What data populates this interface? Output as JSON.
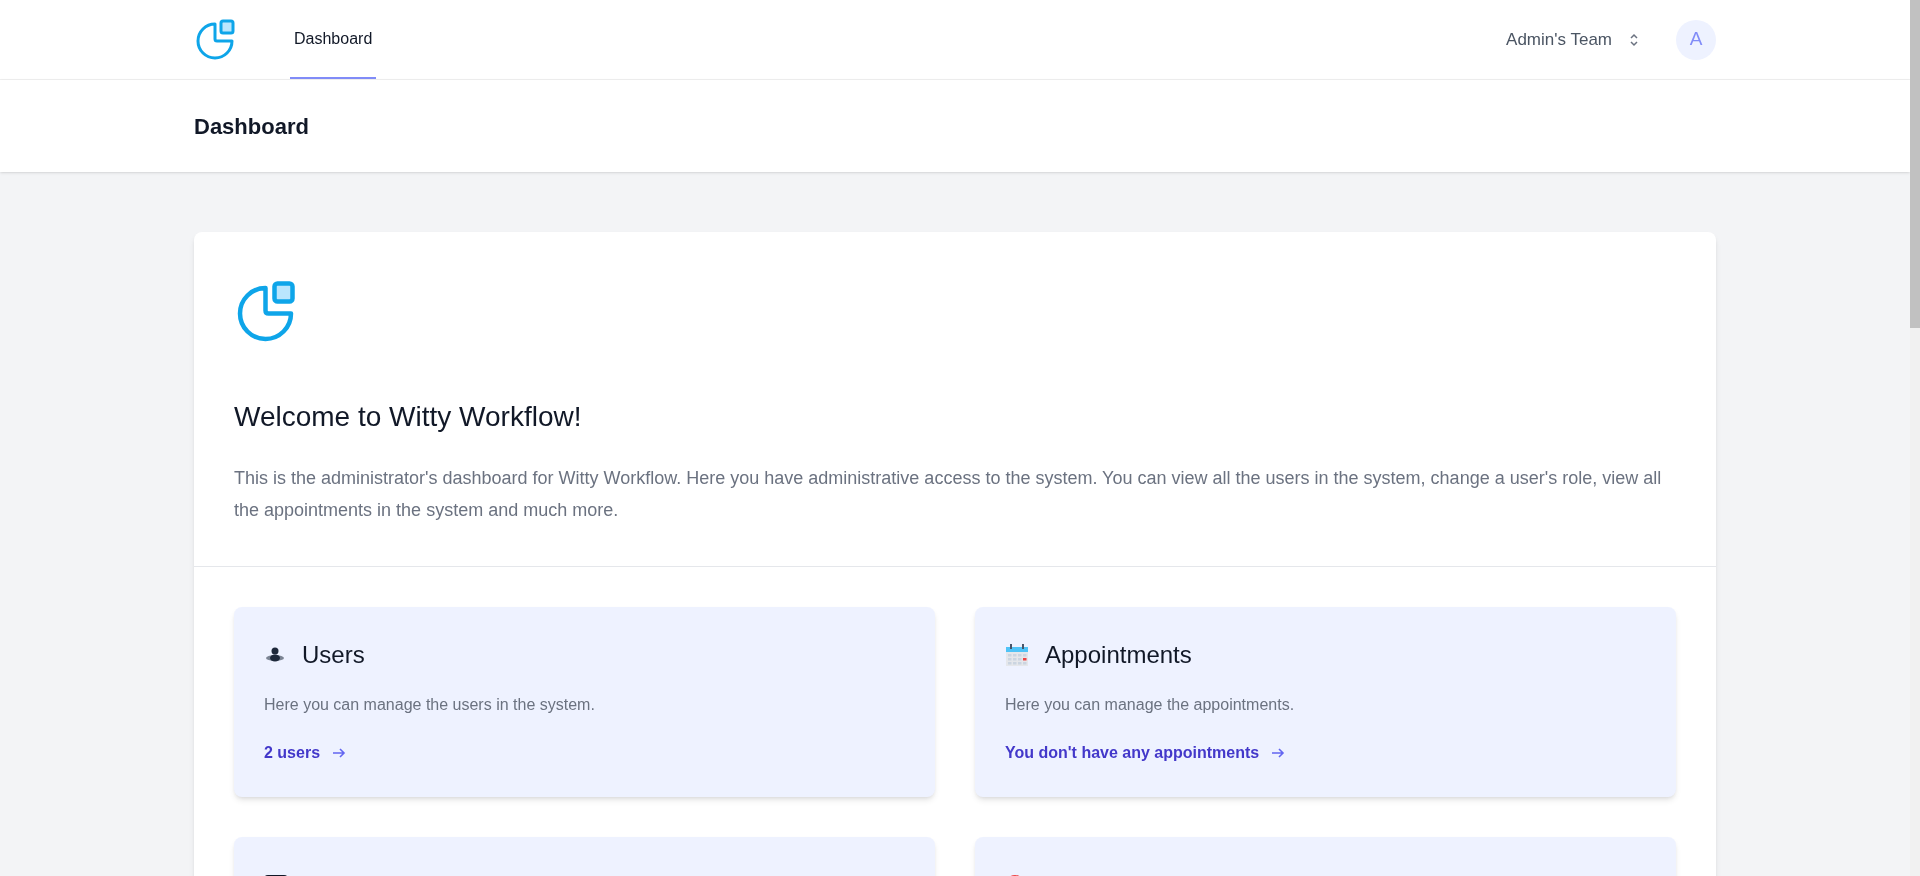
{
  "nav": {
    "tabs": [
      {
        "label": "Dashboard",
        "selected": true
      }
    ],
    "team": "Admin's Team",
    "avatar": "A"
  },
  "header": {
    "title": "Dashboard"
  },
  "welcome": {
    "title": "Welcome to Witty Workflow!",
    "text": "This is the administrator's dashboard for Witty Workflow. Here you have administrative access to the system. You can view all the users in the system, change a user's role, view all the appointments in the system and much more."
  },
  "cards": [
    {
      "kind": "users",
      "title": "Users",
      "text": "Here you can manage the users in the system.",
      "link": "2 users"
    },
    {
      "kind": "appointments",
      "title": "Appointments",
      "text": "Here you can manage the appointments.",
      "link": "You don't have any appointments"
    },
    {
      "kind": "dark-square"
    },
    {
      "kind": "red-outline"
    }
  ]
}
